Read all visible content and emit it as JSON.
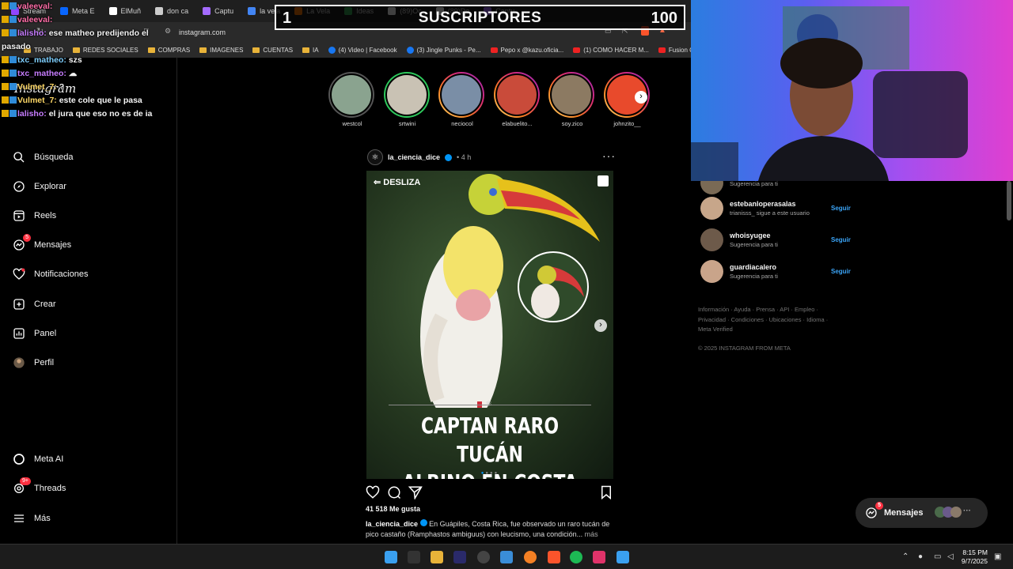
{
  "browser": {
    "tabs": [
      {
        "label": "Stream",
        "color": "#9146ff"
      },
      {
        "label": "Meta E",
        "color": "#0866ff"
      },
      {
        "label": "ElMuñ",
        "color": "#ffffff"
      },
      {
        "label": "don ca",
        "color": "#cccccc"
      },
      {
        "label": "Captu",
        "color": "#a46bff"
      },
      {
        "label": "la vela",
        "color": "#4285f4"
      },
      {
        "label": "La Vela",
        "color": "#ff7a00"
      },
      {
        "label": "Ideas",
        "color": "#34a853"
      },
      {
        "label": "(89)Oc",
        "color": "#ffffff"
      },
      {
        "label": "(89)De",
        "color": "#ffffff"
      },
      {
        "label": "Captu",
        "color": "#a46bff"
      }
    ],
    "url": "instagram.com",
    "bookmarks": [
      {
        "label": "TRABAJO",
        "kind": "folder"
      },
      {
        "label": "REDES SOCIALES",
        "kind": "folder"
      },
      {
        "label": "COMPRAS",
        "kind": "folder"
      },
      {
        "label": "IMAGENES",
        "kind": "folder"
      },
      {
        "label": "CUENTAS",
        "kind": "folder"
      },
      {
        "label": "IA",
        "kind": "folder"
      },
      {
        "label": "(4) Video | Facebook",
        "kind": "fb"
      },
      {
        "label": "(3) Jingle Punks - Pe...",
        "kind": "fb"
      },
      {
        "label": "Pepo x @kazu.oficia...",
        "kind": "yt"
      },
      {
        "label": "(1) COMO HACER M...",
        "kind": "yt"
      },
      {
        "label": "Fusion Cl",
        "kind": "yt"
      }
    ]
  },
  "overlay": {
    "left_num": "1",
    "title": "SUSCRIPTORES",
    "right_num": "100"
  },
  "chat": [
    {
      "user": "valeeval:",
      "msg": "",
      "ucls": "u2"
    },
    {
      "user": "valeeval:",
      "msg": "",
      "ucls": "u2"
    },
    {
      "user": "lalisho:",
      "msg": "ese matheo predijendo el",
      "ucls": "u1"
    },
    {
      "user": "",
      "msg": "pasado",
      "ucls": "u1"
    },
    {
      "user": "txc_matheo:",
      "msg": "szs",
      "ucls": "u3"
    },
    {
      "user": "txc_matheo:",
      "msg": "☁",
      "ucls": "u1"
    },
    {
      "user": "Vulmet_7:",
      "msg": "?",
      "ucls": "u4"
    },
    {
      "user": "Vulmet_7:",
      "msg": "este cole que le pasa",
      "ucls": "u4"
    },
    {
      "user": "lalisho:",
      "msg": "el jura que eso no es de ia",
      "ucls": "u1"
    }
  ],
  "nav": {
    "logo": "Instagram",
    "items": [
      {
        "label": "Búsqueda",
        "icon": "search-icon"
      },
      {
        "label": "Explorar",
        "icon": "compass-icon"
      },
      {
        "label": "Reels",
        "icon": "reels-icon"
      },
      {
        "label": "Mensajes",
        "icon": "messenger-icon",
        "badge": "5"
      },
      {
        "label": "Notificaciones",
        "icon": "heart-icon"
      },
      {
        "label": "Crear",
        "icon": "plus-square-icon"
      },
      {
        "label": "Panel",
        "icon": "chart-icon"
      },
      {
        "label": "Perfil",
        "icon": "profile-avatar-icon"
      }
    ],
    "bottom": [
      {
        "label": "Meta AI",
        "icon": "meta-ai-icon"
      },
      {
        "label": "Threads",
        "icon": "threads-icon",
        "badge": "9+"
      },
      {
        "label": "Más",
        "icon": "menu-icon"
      }
    ]
  },
  "stories": [
    {
      "name": "westcol",
      "ring": "grey",
      "color": "#8aa38f"
    },
    {
      "name": "srtwini",
      "ring": "green",
      "color": "#c9c2b4"
    },
    {
      "name": "neciocol",
      "ring": "grad",
      "color": "#7a8ea6"
    },
    {
      "name": "elabuelito...",
      "ring": "grad",
      "color": "#c94b3a"
    },
    {
      "name": "soy.zico",
      "ring": "grad",
      "color": "#8c7a62"
    },
    {
      "name": "johnzito__",
      "ring": "grad",
      "color": "#e84a2c"
    }
  ],
  "post": {
    "username": "la_ciencia_dice",
    "time": "• 4 h",
    "swipe_label": "DESLIZA",
    "headline_1": "CAPTAN RARO TUCÁN",
    "headline_2": "ALBINO EN COSTA RICA",
    "likes": "41 518 Me gusta",
    "caption_user": "la_ciencia_dice",
    "caption": "En Guápiles, Costa Rica, fue observado un raro tucán de pico castaño (Ramphastos ambiguus) con leucismo, una condición...",
    "caption_more": "más",
    "carousel_index": 1,
    "carousel_total": 4
  },
  "suggestions": [
    {
      "name": "",
      "sub": "Sugerencia para ti",
      "follow": "",
      "color": "#7a6a55"
    },
    {
      "name": "estebanloperasalas",
      "sub": "trianisss_ sigue a este usuario",
      "follow": "Seguir",
      "color": "#c7a68a"
    },
    {
      "name": "whoisyugee",
      "sub": "Sugerencia para ti",
      "follow": "Seguir",
      "color": "#6d5a4a"
    },
    {
      "name": "guardiacalero",
      "sub": "Sugerencia para ti",
      "follow": "Seguir",
      "color": "#c9a48a"
    }
  ],
  "footer": {
    "links_1": "Información · Ayuda · Prensa · API · Empleo ·",
    "links_2": "Privacidad · Condiciones · Ubicaciones · Idioma ·",
    "links_3": "Meta Verified",
    "copyright": "© 2025 INSTAGRAM FROM META"
  },
  "messages_pill": {
    "label": "Mensajes",
    "badge": "5"
  },
  "taskbar": {
    "time": "8:15 PM",
    "date": "9/7/2025"
  }
}
